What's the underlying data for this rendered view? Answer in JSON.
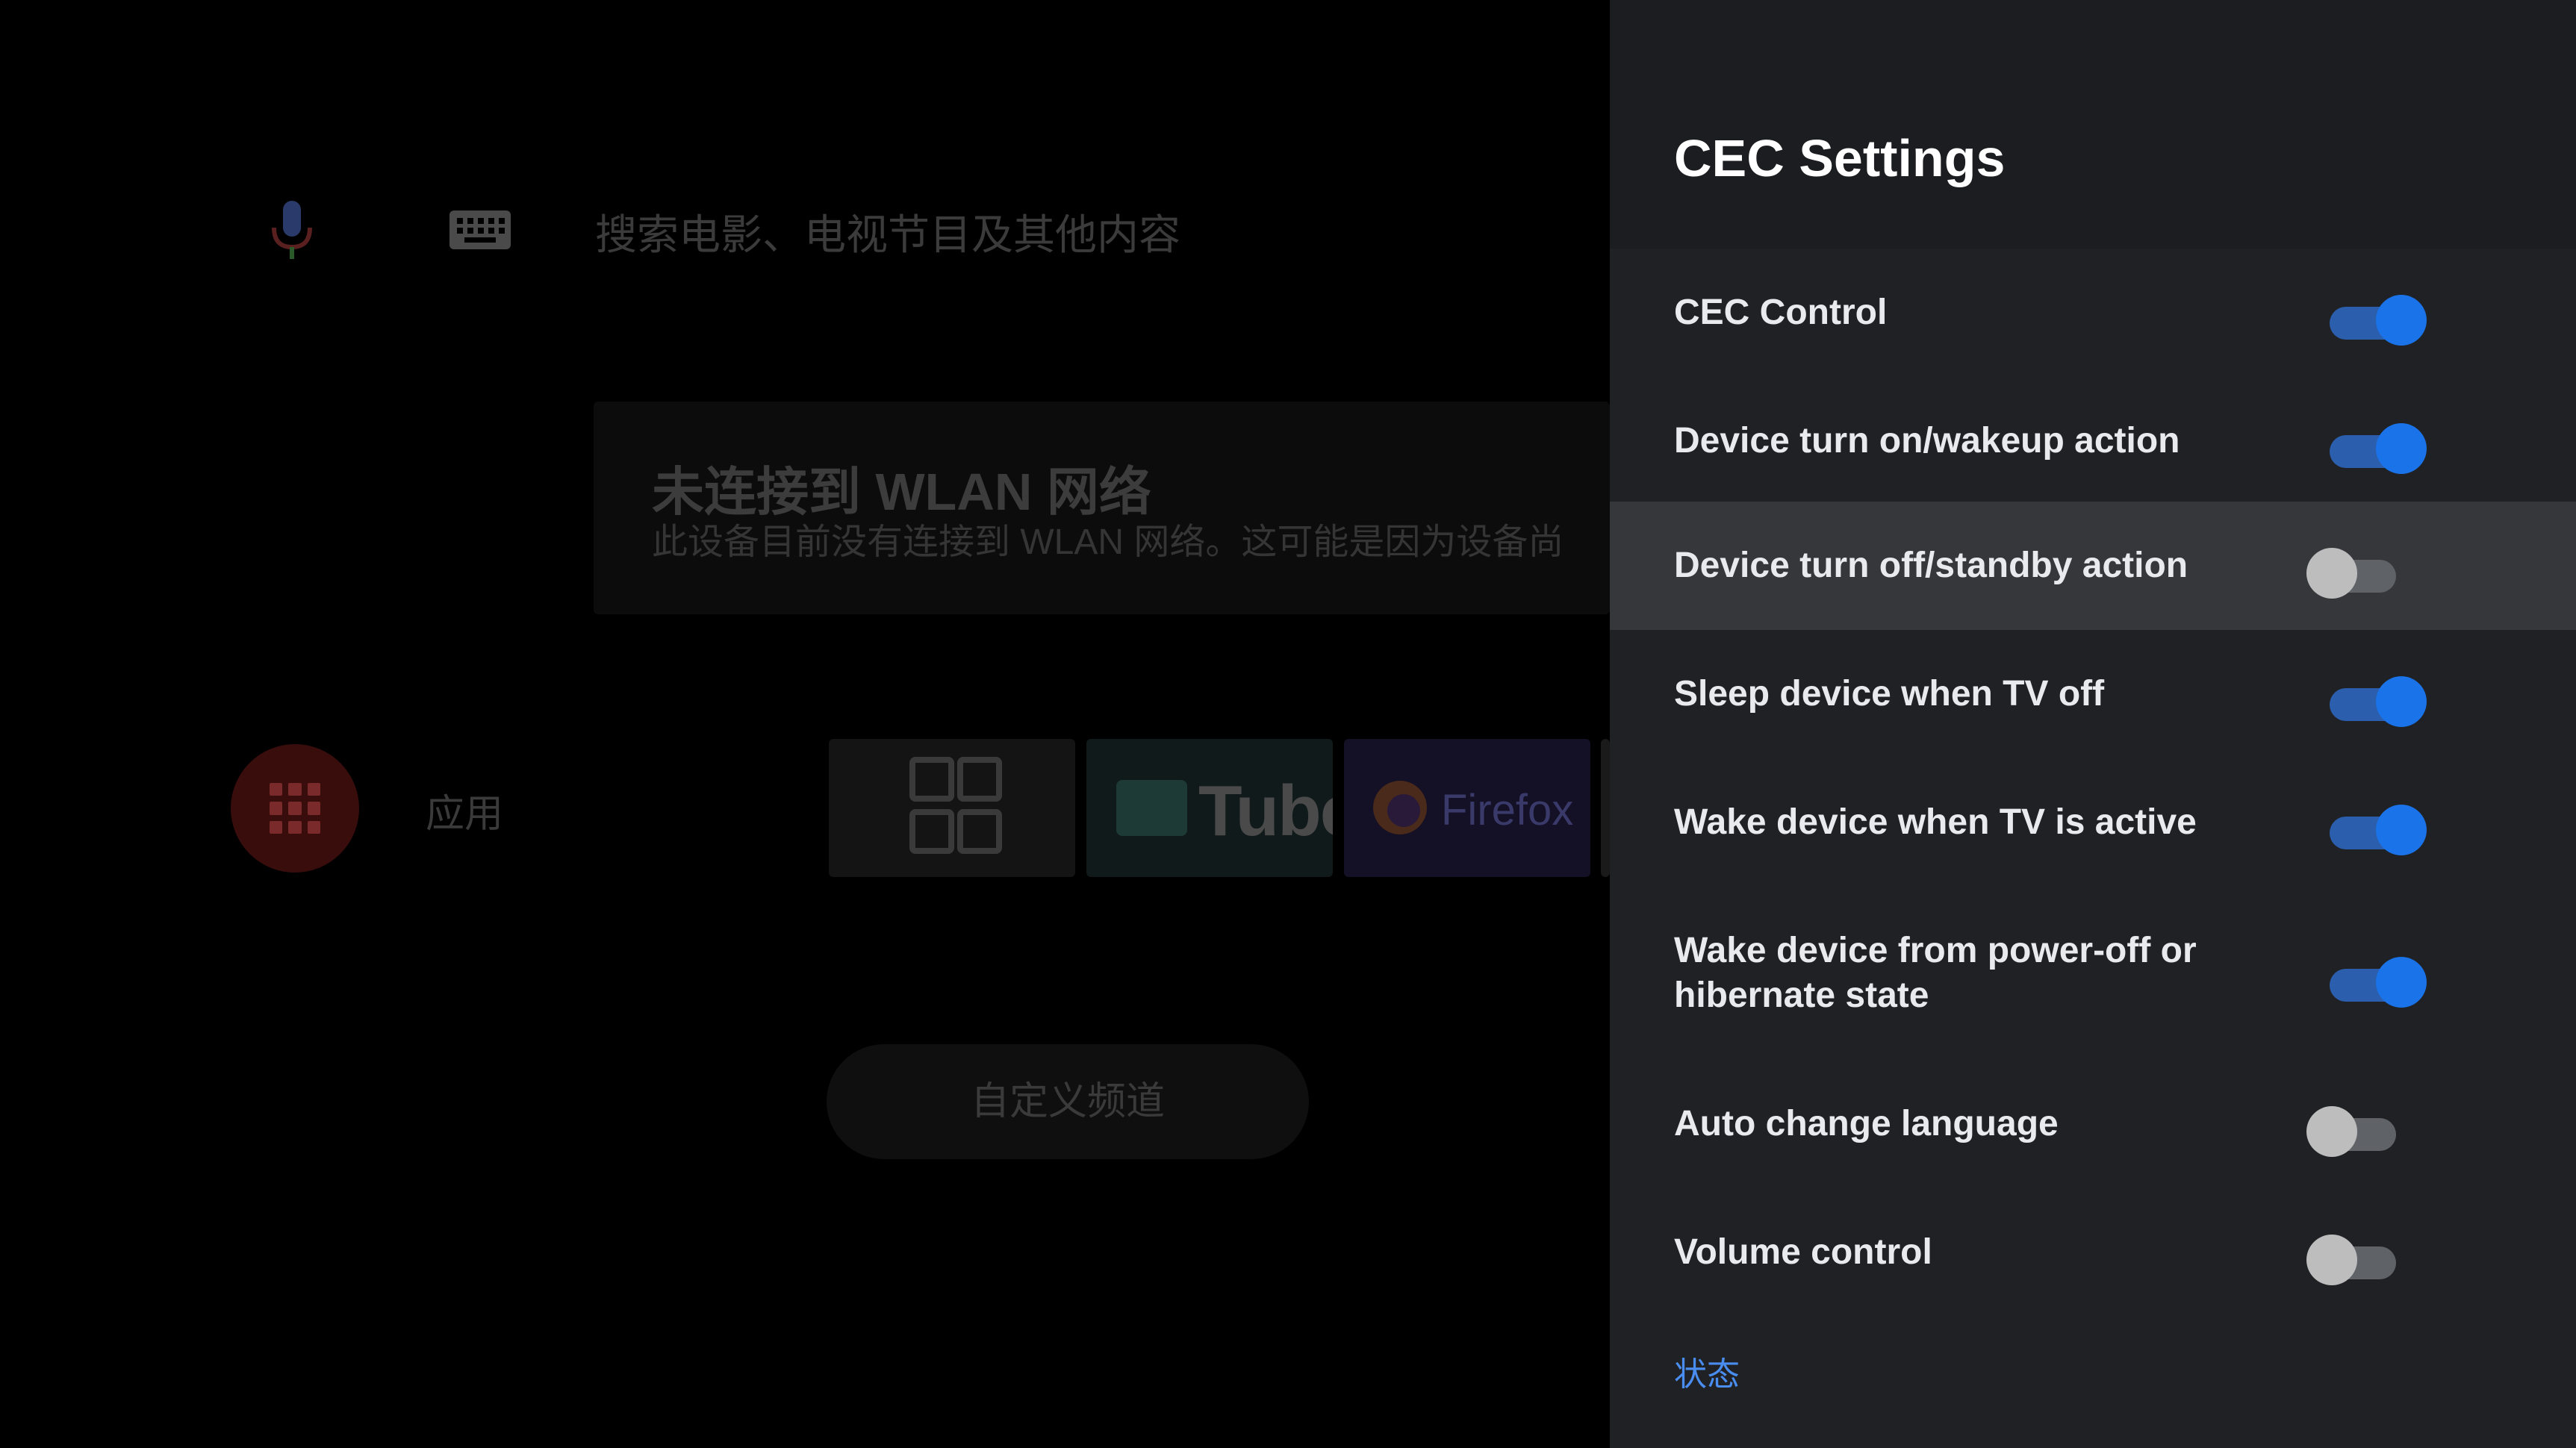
{
  "launcher": {
    "search_hint": "搜索电影、电视节目及其他内容",
    "wlan_title": "未连接到 WLAN 网络",
    "wlan_subtitle": "此设备目前没有连接到 WLAN 网络。这可能是因为设备尚",
    "apps_label": "应用",
    "app_tiles": [
      "Tube",
      "Firefox"
    ],
    "custom_channel_button": "自定义频道",
    "icons": [
      "mic-icon",
      "keyboard-icon",
      "apps-grid-icon"
    ]
  },
  "panel": {
    "title": "CEC Settings",
    "items": [
      {
        "label": "CEC Control",
        "on": true
      },
      {
        "label": "Device turn on/wakeup action",
        "on": true
      },
      {
        "label": "Device turn off/standby action",
        "on": false,
        "focused": true
      },
      {
        "label": "Sleep device when TV off",
        "on": true
      },
      {
        "label": "Wake device when TV is active",
        "on": true
      },
      {
        "label": "Wake device from power-off or",
        "label_line2": "hibernate state",
        "on": true
      },
      {
        "label": "Auto change language",
        "on": false
      },
      {
        "label": "Volume control",
        "on": false
      }
    ],
    "status_link": "状态"
  },
  "colors": {
    "panel_bg": "#202124",
    "accent": "#1a73e8",
    "focus_row": "#36373b",
    "link": "#4a8df0"
  }
}
